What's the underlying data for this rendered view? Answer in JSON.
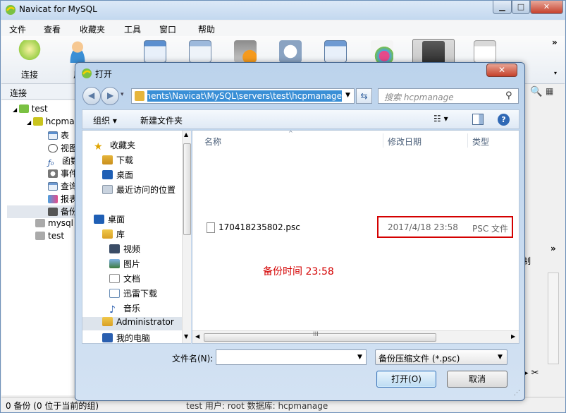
{
  "window": {
    "title": "Navicat for MySQL",
    "controls": {
      "minimize": "▁",
      "maximize": "□",
      "close": "✕"
    }
  },
  "menu": [
    "文件",
    "查看",
    "收藏夹",
    "工具",
    "窗口",
    "帮助"
  ],
  "toolbar": {
    "connect_label": "连接",
    "user_label": "用",
    "more": "»",
    "more_small": "▾"
  },
  "left_panel": {
    "header": "连接",
    "tree": [
      {
        "label": "test",
        "icon": "connection-icon"
      },
      {
        "label": "hcpma",
        "icon": "database-icon"
      },
      {
        "label": "表",
        "icon": "table-icon"
      },
      {
        "label": "视图",
        "icon": "view-icon"
      },
      {
        "label": "函数",
        "icon": "function-icon"
      },
      {
        "label": "事件",
        "icon": "event-icon"
      },
      {
        "label": "查询",
        "icon": "query-icon"
      },
      {
        "label": "报表",
        "icon": "report-icon"
      },
      {
        "label": "备份",
        "icon": "backup-icon"
      },
      {
        "label": "mysql",
        "icon": "database-icon"
      },
      {
        "label": "test",
        "icon": "database-icon"
      }
    ]
  },
  "right_partial": {
    "tab_text": "制",
    "tab_arrow": "»"
  },
  "status": {
    "left": "0 备份 (0 位于当前的组)",
    "right": "test   用户: root   数据库: hcpmanage"
  },
  "dialog": {
    "title": "打开",
    "close": "✕",
    "address": "ments\\Navicat\\MySQL\\servers\\test\\hcpmanage",
    "search_placeholder": "搜索 hcpmanage",
    "organize": "组织 ▾",
    "new_folder": "新建文件夹",
    "help": "?",
    "nav": {
      "favorites": "收藏夹",
      "downloads": "下载",
      "desktop_fav": "桌面",
      "recent": "最近访问的位置",
      "desktop": "桌面",
      "library": "库",
      "videos": "视频",
      "pictures": "图片",
      "documents": "文档",
      "thunder": "迅雷下载",
      "music": "音乐",
      "admin": "Administrator",
      "computer": "我的电脑"
    },
    "columns": {
      "name": "名称",
      "modified": "修改日期",
      "type": "类型"
    },
    "files": [
      {
        "name": "170418235802.psc",
        "modified": "2017/4/18 23:58",
        "type": "PSC 文件"
      }
    ],
    "annotation": "备份时间   23:58",
    "filename_label": "文件名(N):",
    "filename_value": "",
    "filter": "备份压缩文件 (*.psc)",
    "open_button": "打开(O)",
    "cancel_button": "取消"
  },
  "colors": {
    "highlight": "#d40000",
    "selection": "#3a8fd6",
    "title_gradient_top": "#dce9f7"
  }
}
